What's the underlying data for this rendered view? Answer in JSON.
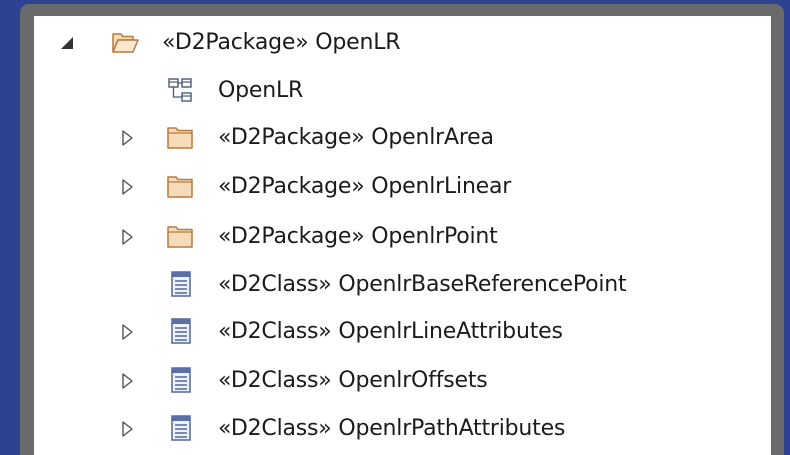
{
  "tree": {
    "items": [
      {
        "label": "«D2Package» OpenLR",
        "icon": "open-folder-icon",
        "expander": "expanded"
      },
      {
        "label": "OpenLR",
        "icon": "class-diagram-icon",
        "expander": "none"
      },
      {
        "label": "«D2Package» OpenlrArea",
        "icon": "folder-icon",
        "expander": "collapsed"
      },
      {
        "label": "«D2Package» OpenlrLinear",
        "icon": "folder-icon",
        "expander": "collapsed"
      },
      {
        "label": "«D2Package» OpenlrPoint",
        "icon": "folder-icon",
        "expander": "collapsed"
      },
      {
        "label": "«D2Class» OpenlrBaseReferencePoint",
        "icon": "class-icon",
        "expander": "none"
      },
      {
        "label": "«D2Class» OpenlrLineAttributes",
        "icon": "class-icon",
        "expander": "collapsed"
      },
      {
        "label": "«D2Class» OpenlrOffsets",
        "icon": "class-icon",
        "expander": "collapsed"
      },
      {
        "label": "«D2Class» OpenlrPathAttributes",
        "icon": "class-icon",
        "expander": "collapsed"
      }
    ]
  },
  "colors": {
    "background": "#2f4291",
    "frame": "#6a6a6a",
    "panel": "#ffffff",
    "folder_fill": "#f6dbb9",
    "folder_stroke": "#b77a3f",
    "class_icon": "#5a6fa3",
    "text": "#1b1b1b"
  }
}
